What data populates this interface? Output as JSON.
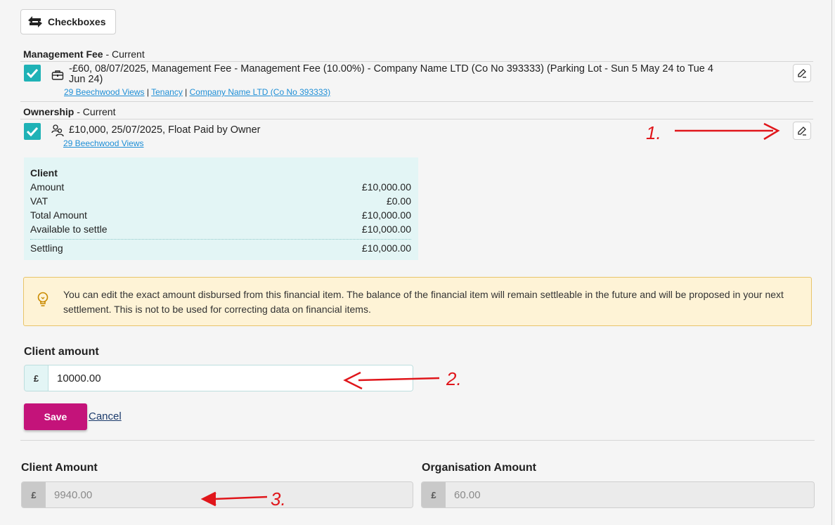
{
  "toolbar": {
    "checkboxes_label": "Checkboxes"
  },
  "groups": [
    {
      "name": "Management Fee",
      "status": " - Current"
    },
    {
      "name": "Ownership",
      "status": " - Current"
    }
  ],
  "items": [
    {
      "text_line1": "-£60, 08/07/2025, Management Fee - Management Fee (10.00%) - Company Name LTD (Co No 393333) (Parking Lot - Sun 5 May 24 to Tue 4",
      "text_line2": "Jun 24)",
      "links": [
        "29 Beechwood Views",
        "Tenancy",
        "Company Name LTD (Co No 393333)"
      ],
      "separator": "|",
      "icon": "briefcase-icon"
    },
    {
      "text_line1": "£10,000, 25/07/2025, Float Paid by Owner",
      "links": [
        "29 Beechwood Views"
      ],
      "icon": "people-icon"
    }
  ],
  "summary": {
    "title": "Client",
    "rows": [
      {
        "label": "Amount",
        "value": "£10,000.00"
      },
      {
        "label": "VAT",
        "value": "£0.00"
      },
      {
        "label": "Total Amount",
        "value": "£10,000.00"
      },
      {
        "label": "Available to settle",
        "value": "£10,000.00"
      }
    ],
    "settling": {
      "label": "Settling",
      "value": "£10,000.00"
    }
  },
  "notice": {
    "text": "You can edit the exact amount disbursed from this financial item. The balance of the financial item will remain settleable in the future and will be proposed in your next settlement. This is not to be used for correcting data on financial items."
  },
  "client_amount_form": {
    "label": "Client amount",
    "currency": "£",
    "value": "10000.00",
    "save_label": "Save",
    "cancel_label": "Cancel"
  },
  "totals": {
    "client": {
      "label": "Client Amount",
      "currency": "£",
      "value": "9940.00"
    },
    "organisation": {
      "label": "Organisation Amount",
      "currency": "£",
      "value": "60.00"
    }
  },
  "annotations": [
    "1.",
    "2.",
    "3."
  ],
  "colors": {
    "checkbox": "#1fb2b6",
    "save": "#c4137a",
    "link": "#1f8fd6",
    "annotation": "#e0161b"
  }
}
